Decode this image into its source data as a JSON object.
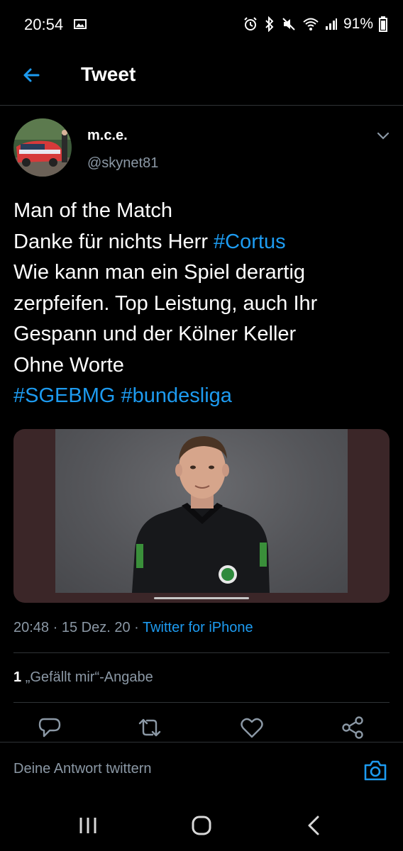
{
  "status_bar": {
    "time": "20:54",
    "battery": "91%"
  },
  "header": {
    "title": "Tweet"
  },
  "author": {
    "name": "m.c.e.",
    "handle": "@skynet81"
  },
  "tweet": {
    "lines": [
      [
        "Man of the Match"
      ],
      [
        "Danke für nichts Herr ",
        "#Cortus"
      ],
      [
        "Wie kann man ein Spiel derartig"
      ],
      [
        "zerpfeifen. Top Leistung, auch Ihr"
      ],
      [
        "Gespann und der Kölner Keller"
      ],
      [
        "Ohne Worte"
      ],
      [
        "",
        "#SGEBMG",
        " ",
        "#bundesliga"
      ]
    ],
    "text_line1": "Man of the Match",
    "text_line2_pre": "Danke für nichts Herr ",
    "hashtag1": "#Cortus",
    "text_line3": "Wie kann man ein Spiel derartig",
    "text_line4": "zerpfeifen. Top Leistung, auch Ihr",
    "text_line5": "Gespann und der Kölner Keller",
    "text_line6": "Ohne Worte",
    "hashtag2": "#SGEBMG",
    "hashtag3": "#bundesliga"
  },
  "meta": {
    "time": "20:48",
    "sep1": " · ",
    "date": "15 Dez. 20",
    "sep2": " · ",
    "source": "Twitter for iPhone"
  },
  "likes": {
    "count": "1",
    "label": "„Gefällt mir“-Angabe"
  },
  "reply": {
    "placeholder": "Deine Antwort twittern"
  },
  "colors": {
    "accent": "#1d9bf0",
    "background": "#000000",
    "secondary_text": "#8b98a5",
    "divider": "#2f3336"
  },
  "icons": [
    "image-icon",
    "alarm-icon",
    "bluetooth-icon",
    "mute-icon",
    "wifi-icon",
    "signal-icon",
    "battery-icon",
    "back-arrow-icon",
    "chevron-down-icon",
    "reply-icon",
    "retweet-icon",
    "like-icon",
    "share-icon",
    "camera-icon",
    "recent-apps-icon",
    "home-icon",
    "back-icon"
  ]
}
